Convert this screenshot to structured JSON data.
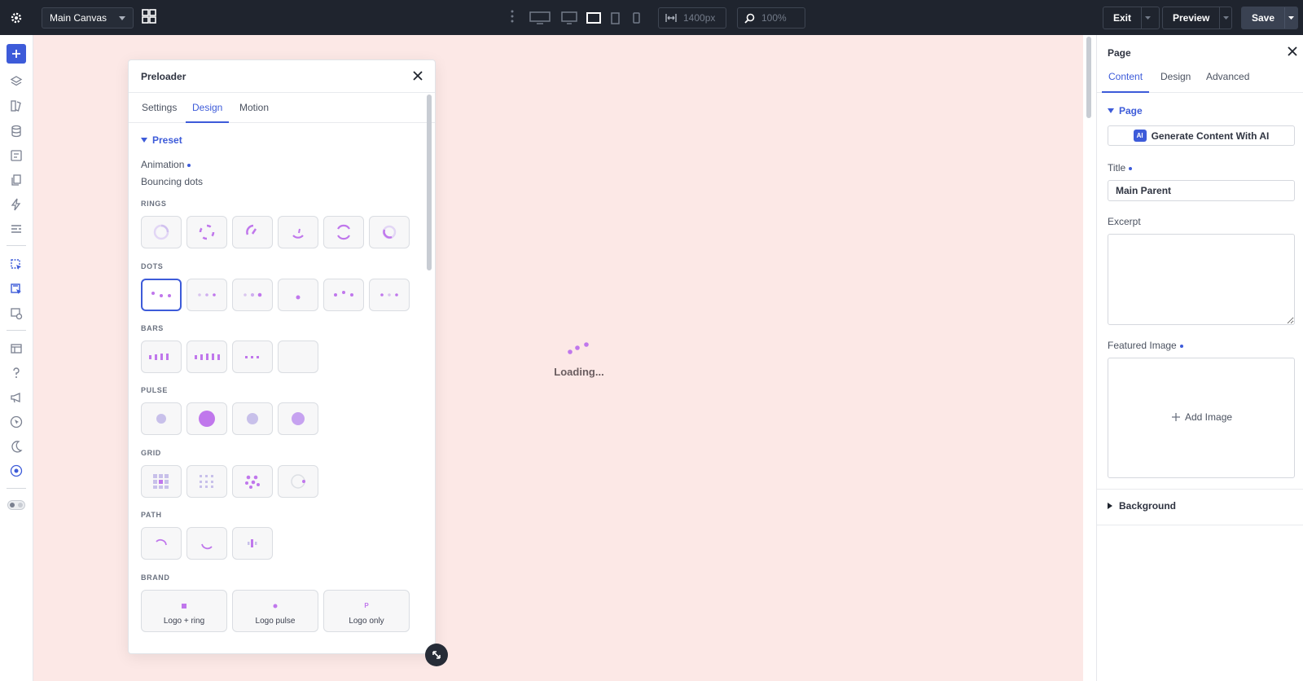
{
  "topbar": {
    "canvas_select": "Main Canvas",
    "width_value": "1400px",
    "zoom_value": "100%",
    "exit_label": "Exit",
    "preview_label": "Preview",
    "save_label": "Save",
    "active_device": "tablet-landscape"
  },
  "sidebar": {
    "icons": [
      "add-icon",
      "layers-icon",
      "library-icon",
      "database-icon",
      "form-icon",
      "pages-icon",
      "lightning-icon",
      "template-icon",
      "pointer-select-icon",
      "pointer-select-alt-icon",
      "image-settings-icon",
      "windows-icon",
      "help-icon",
      "megaphone-icon",
      "cursor-icon",
      "moon-icon",
      "target-icon",
      "toggle-icon"
    ]
  },
  "canvas": {
    "loading_text": "Loading...",
    "background": "#fce8e6",
    "loader_color": "#c077ec"
  },
  "modal": {
    "title": "Preloader",
    "tabs": [
      "Settings",
      "Design",
      "Motion"
    ],
    "active_tab": "Design",
    "section": "Preset",
    "animation_label": "Animation",
    "animation_value": "Bouncing dots",
    "groups": {
      "rings": "RINGS",
      "dots": "DOTS",
      "bars": "BARS",
      "pulse": "PULSE",
      "grid": "GRID",
      "path": "PATH",
      "brand": "BRAND"
    },
    "brand_tiles": [
      "Logo + ring",
      "Logo pulse",
      "Logo only"
    ],
    "brand_only_glyph": "P"
  },
  "panel": {
    "title": "Page",
    "tabs": [
      "Content",
      "Design",
      "Advanced"
    ],
    "active_tab": "Content",
    "section": "Page",
    "ai_badge": "AI",
    "ai_button": "Generate Content With AI",
    "title_label": "Title",
    "title_value": "Main Parent",
    "excerpt_label": "Excerpt",
    "excerpt_value": "",
    "featured_label": "Featured Image",
    "add_image": "Add Image",
    "background_label": "Background"
  },
  "colors": {
    "accent": "#3d5bd9",
    "topbar": "#1f242e",
    "preset_purple": "#c077ec"
  }
}
